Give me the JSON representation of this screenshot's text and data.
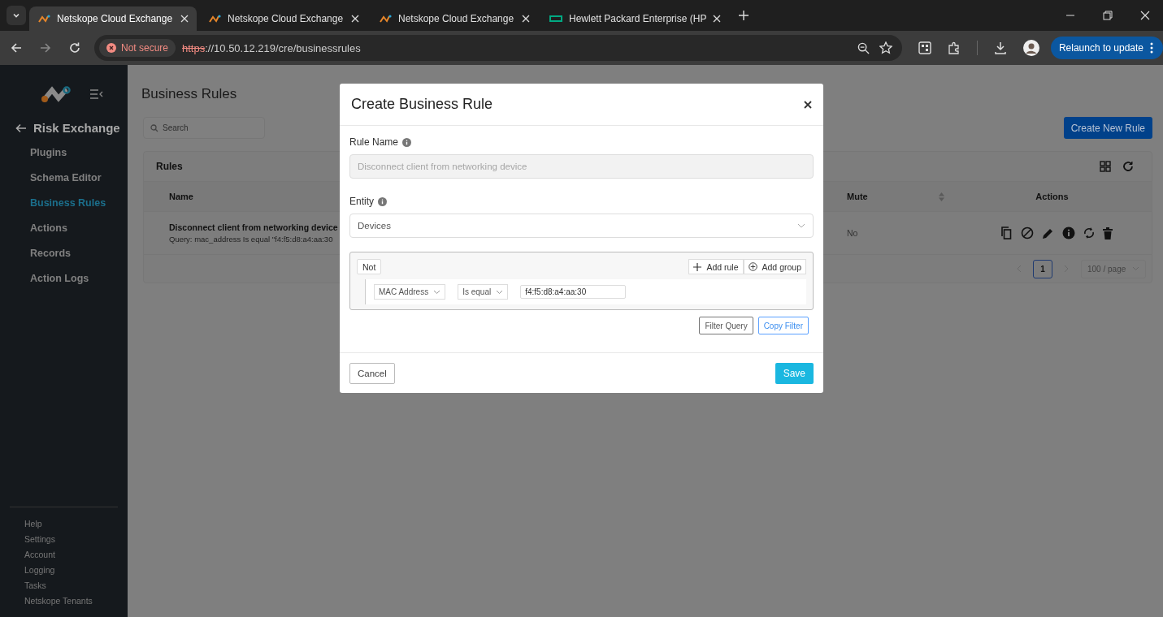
{
  "browser": {
    "tabs": [
      {
        "title": "Netskope Cloud Exchange",
        "kind": "netskope",
        "selected": true
      },
      {
        "title": "Netskope Cloud Exchange",
        "kind": "netskope",
        "selected": false
      },
      {
        "title": "Netskope Cloud Exchange",
        "kind": "netskope",
        "selected": false
      },
      {
        "title": "Hewlett Packard Enterprise (HP",
        "kind": "hpe",
        "selected": false
      }
    ],
    "security": "Not secure",
    "url_scheme": "https",
    "url_rest": "://10.50.12.219/cre/businessrules",
    "relaunch": "Relaunch to update"
  },
  "sidebar": {
    "back_title": "Risk Exchange",
    "items": [
      {
        "label": "Plugins",
        "selected": false
      },
      {
        "label": "Schema Editor",
        "selected": false
      },
      {
        "label": "Business Rules",
        "selected": true
      },
      {
        "label": "Actions",
        "selected": false
      },
      {
        "label": "Records",
        "selected": false
      },
      {
        "label": "Action Logs",
        "selected": false
      }
    ],
    "footer_items": [
      "Help",
      "Settings",
      "Account",
      "Logging",
      "Tasks",
      "Netskope Tenants"
    ]
  },
  "page": {
    "title": "Business Rules",
    "search": {
      "placeholder": "Search"
    },
    "create_button": "Create New Rule",
    "card_title": "Rules",
    "columns": [
      {
        "label": "Name",
        "sortable": false
      },
      {
        "label": "Mute",
        "sortable": true
      },
      {
        "label": "Actions",
        "sortable": false
      }
    ],
    "rows": [
      {
        "name": "Disconnect client from networking device",
        "query": "Query: mac_address Is equal \"f4:f5:d8:a4:aa:30",
        "mute": "No"
      }
    ],
    "pagination": {
      "pages": [
        {
          "label": "1",
          "selected": true
        }
      ],
      "page_size": "100 / page"
    }
  },
  "modal": {
    "title": "Create Business Rule",
    "rule_name": {
      "label": "Rule Name",
      "value": "Disconnect client from networking device",
      "disabled": true
    },
    "entity": {
      "label": "Entity",
      "value": "Devices"
    },
    "query": {
      "not_label": "Not",
      "add_rule": "Add rule",
      "add_group": "Add group",
      "rules": [
        {
          "field": "MAC Address",
          "operator": "Is equal",
          "value": "f4:f5:d8:a4:aa:30"
        }
      ]
    },
    "filter_query": "Filter Query",
    "copy_filter": "Copy Filter",
    "cancel": "Cancel",
    "save": "Save"
  }
}
